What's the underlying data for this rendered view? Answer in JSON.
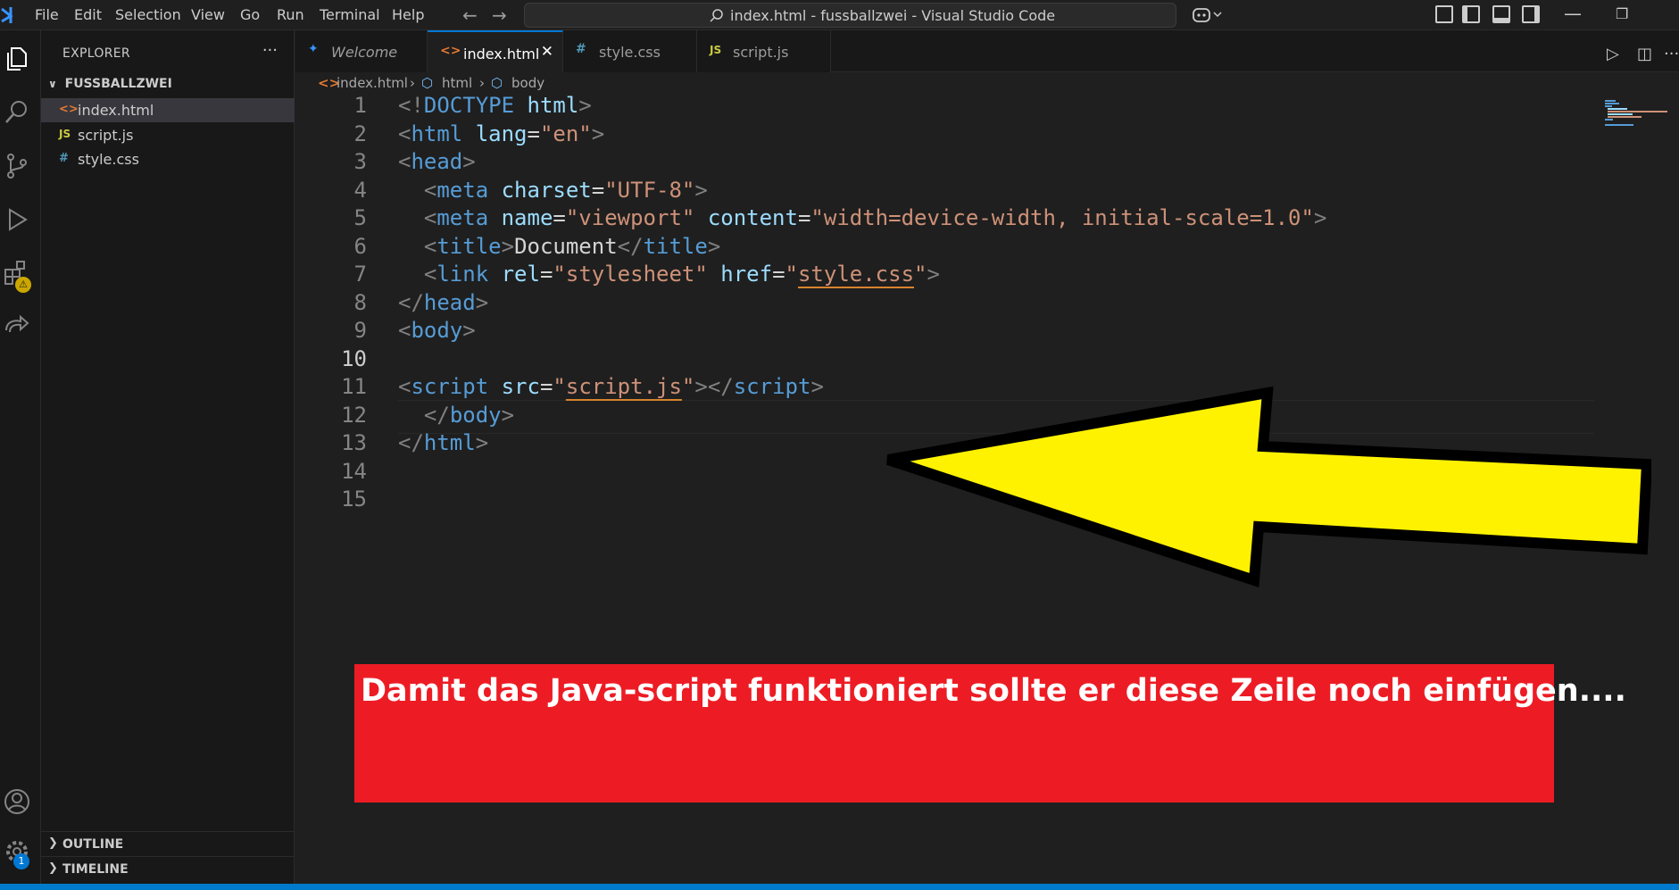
{
  "menu": [
    "File",
    "Edit",
    "Selection",
    "View",
    "Go",
    "Run",
    "Terminal",
    "Help"
  ],
  "window_title": "index.html - fussballzwei - Visual Studio Code",
  "sidebar": {
    "title": "EXPLORER",
    "more": "···",
    "folder": "FUSSBALLZWEI",
    "files": [
      {
        "icon": "<>",
        "name": "index.html",
        "color": "#e37933"
      },
      {
        "icon": "JS",
        "name": "script.js",
        "color": "#cbcb41"
      },
      {
        "icon": "#",
        "name": "style.css",
        "color": "#519aba"
      }
    ],
    "outline": "OUTLINE",
    "timeline": "TIMELINE"
  },
  "activity": {
    "extensions_badge": "⚠",
    "settings_badge": "1"
  },
  "tabs": [
    {
      "label": "Welcome",
      "icon": "✦",
      "color": "#3794ff"
    },
    {
      "label": "index.html",
      "icon": "<>",
      "color": "#e37933",
      "close": "✕"
    },
    {
      "label": "style.css",
      "icon": "#",
      "color": "#519aba"
    },
    {
      "label": "script.js",
      "icon": "JS",
      "color": "#cbcb41"
    }
  ],
  "breadcrumb": [
    "index.html",
    "html",
    "body"
  ],
  "line_numbers": [
    "1",
    "2",
    "3",
    "4",
    "5",
    "6",
    "7",
    "8",
    "9",
    "10",
    "11",
    "12",
    "13",
    "14",
    "15"
  ],
  "code": {
    "l1": {
      "open": "<!",
      "tag": "DOCTYPE",
      "attr": "html",
      "close": ">"
    },
    "l2": {
      "open": "<",
      "tag": "html",
      "attr": "lang",
      "eq": "=",
      "val": "\"en\"",
      "close": ">"
    },
    "l3": {
      "open": "<",
      "tag": "head",
      "close": ">"
    },
    "l4": {
      "open": "<",
      "tag": "meta",
      "attr": "charset",
      "eq": "=",
      "val": "\"UTF-8\"",
      "close": ">"
    },
    "l5": {
      "open": "<",
      "tag": "meta",
      "attr1": "name",
      "eq": "=",
      "val1": "\"viewport\"",
      "attr2": "content",
      "val2": "\"width=device-width, initial-scale=1.0\"",
      "close": ">"
    },
    "l6": {
      "open": "<",
      "tag": "title",
      "close": ">",
      "text": "Document",
      "open2": "</",
      "tag2": "title",
      "close2": ">"
    },
    "l7": {
      "open": "<",
      "tag": "link",
      "attr1": "rel",
      "eq": "=",
      "val1": "\"stylesheet\"",
      "attr2": "href",
      "q": "\"",
      "val2": "style.css",
      "close": ">"
    },
    "l8": {
      "open": "</",
      "tag": "head",
      "close": ">"
    },
    "l9": {
      "open": "<",
      "tag": "body",
      "close": ">"
    },
    "l11": {
      "open": "<",
      "tag": "script",
      "attr": "src",
      "eq": "=",
      "q": "\"",
      "val": "script.js",
      "close": ">",
      "open2": "</",
      "tag2": "script",
      "close2": ">"
    },
    "l12": {
      "open": "</",
      "tag": "body",
      "close": ">"
    },
    "l13": {
      "open": "</",
      "tag": "html",
      "close": ">"
    }
  },
  "annotation": {
    "text": "Damit das Java-script funktioniert sollte er diese Zeile noch einfügen....",
    "box_color": "#ed1c24",
    "arrow_color": "#fff200"
  }
}
